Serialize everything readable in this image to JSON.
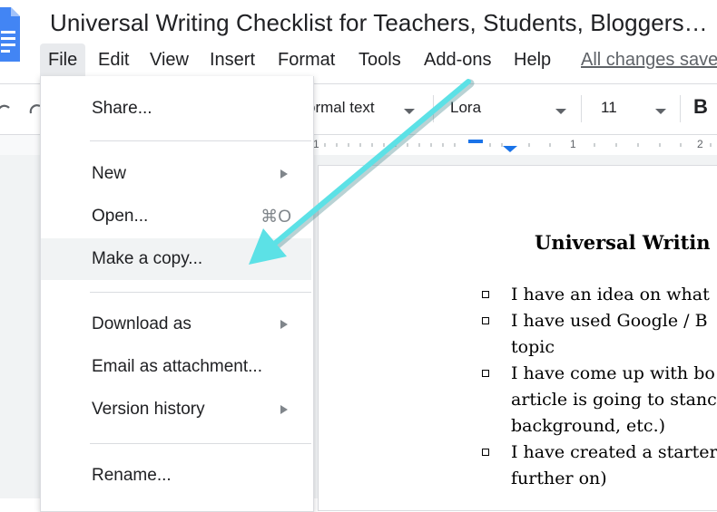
{
  "app": {
    "doc_title": "Universal Writing Checklist for Teachers, Students, Bloggers…",
    "icon": "google-docs-icon",
    "saved_status": "All changes saved"
  },
  "menubar": {
    "items": [
      "File",
      "Edit",
      "View",
      "Insert",
      "Format",
      "Tools",
      "Add-ons",
      "Help"
    ],
    "active": "File"
  },
  "toolbar": {
    "style_value": "ormal text",
    "font_value": "Lora",
    "size_value": "11",
    "bold_label": "B"
  },
  "ruler": {
    "labels": [
      "1",
      "1",
      "2"
    ]
  },
  "file_menu": {
    "items": [
      {
        "label": "Share...",
        "shortcut": "",
        "submenu": false
      },
      {
        "label": "New",
        "shortcut": "",
        "submenu": true
      },
      {
        "label": "Open...",
        "shortcut": "⌘O",
        "submenu": false
      },
      {
        "label": "Make a copy...",
        "shortcut": "",
        "submenu": false,
        "highlighted": true
      },
      {
        "label": "Download as",
        "shortcut": "",
        "submenu": true
      },
      {
        "label": "Email as attachment...",
        "shortcut": "",
        "submenu": false
      },
      {
        "label": "Version history",
        "shortcut": "",
        "submenu": true
      },
      {
        "label": "Rename...",
        "shortcut": "",
        "submenu": false
      }
    ]
  },
  "document": {
    "heading": "Universal Writin",
    "checklist": [
      [
        "I have an idea on what"
      ],
      [
        "I have used Google / B",
        "topic"
      ],
      [
        "I have come up with bo",
        "article is going to stanc",
        "background, etc.)"
      ],
      [
        "I have created a starter",
        "further on)"
      ]
    ]
  },
  "colors": {
    "annotation_arrow": "#5ce1e6",
    "menu_highlight": "#f1f3f4",
    "docs_blue": "#4285f4"
  }
}
